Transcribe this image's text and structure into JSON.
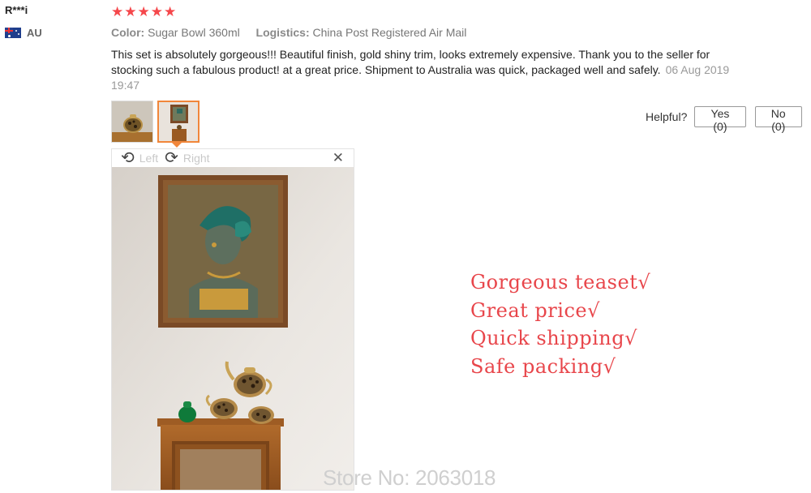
{
  "reviewer": {
    "name": "R***i",
    "country": "AU",
    "flag_icon": "australia-flag-icon"
  },
  "rating": {
    "stars": 5,
    "max": 5,
    "star_color": "#f5474b"
  },
  "attributes": {
    "color_label": "Color:",
    "color_value": "Sugar Bowl 360ml",
    "logistics_label": "Logistics:",
    "logistics_value": "China Post Registered Air Mail"
  },
  "review": {
    "text": "This set is absolutely gorgeous!!! Beautiful finish, gold shiny trim, looks extremely expensive. Thank you to the seller for stocking such a fabulous product! at a great price. Shipment to Australia was quick, packaged well and safely.",
    "date": "06 Aug 2019 19:47"
  },
  "helpful": {
    "label": "Helpful?",
    "yes_label": "Yes (0)",
    "no_label": "No (0)"
  },
  "viewer": {
    "rotate_left_label": "Left",
    "rotate_right_label": "Right",
    "close_icon": "close-icon"
  },
  "promo_lines": [
    "Gorgeous teaset√",
    "Great price√",
    "Quick shipping√",
    "Safe packing√"
  ],
  "promo_color": "#e8464b",
  "watermark": "Store No: 2063018"
}
